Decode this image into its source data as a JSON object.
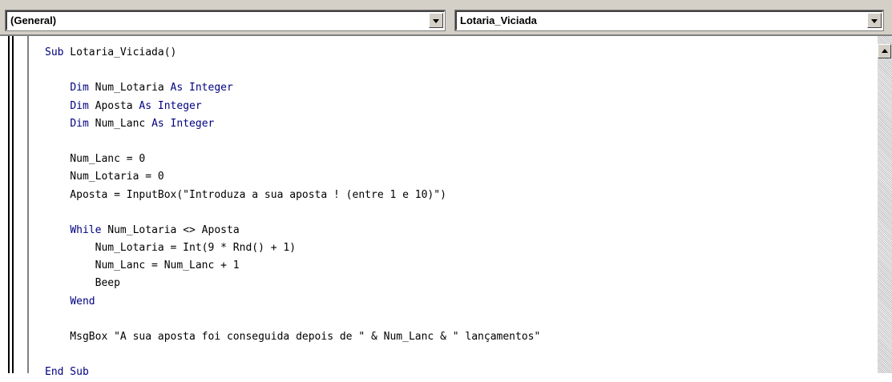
{
  "object_combo": {
    "value": "(General)"
  },
  "procedure_combo": {
    "value": "Lotaria_Viciada"
  },
  "code_lines": [
    [
      {
        "t": "Sub",
        "k": true
      },
      {
        "t": " Lotaria_Viciada()",
        "k": false
      }
    ],
    [],
    [
      {
        "t": "    ",
        "k": false
      },
      {
        "t": "Dim",
        "k": true
      },
      {
        "t": " Num_Lotaria ",
        "k": false
      },
      {
        "t": "As Integer",
        "k": true
      }
    ],
    [
      {
        "t": "    ",
        "k": false
      },
      {
        "t": "Dim",
        "k": true
      },
      {
        "t": " Aposta ",
        "k": false
      },
      {
        "t": "As Integer",
        "k": true
      }
    ],
    [
      {
        "t": "    ",
        "k": false
      },
      {
        "t": "Dim",
        "k": true
      },
      {
        "t": " Num_Lanc ",
        "k": false
      },
      {
        "t": "As Integer",
        "k": true
      }
    ],
    [],
    [
      {
        "t": "    Num_Lanc = 0",
        "k": false
      }
    ],
    [
      {
        "t": "    Num_Lotaria = 0",
        "k": false
      }
    ],
    [
      {
        "t": "    Aposta = InputBox(\"Introduza a sua aposta ! (entre 1 e 10)\")",
        "k": false
      }
    ],
    [],
    [
      {
        "t": "    ",
        "k": false
      },
      {
        "t": "While",
        "k": true
      },
      {
        "t": " Num_Lotaria <> Aposta",
        "k": false
      }
    ],
    [
      {
        "t": "        Num_Lotaria = Int(9 * Rnd() + 1)",
        "k": false
      }
    ],
    [
      {
        "t": "        Num_Lanc = Num_Lanc + 1",
        "k": false
      }
    ],
    [
      {
        "t": "        Beep",
        "k": false
      }
    ],
    [
      {
        "t": "    ",
        "k": false
      },
      {
        "t": "Wend",
        "k": true
      }
    ],
    [],
    [
      {
        "t": "    MsgBox \"A sua aposta foi conseguida depois de \" & Num_Lanc & \" lançamentos\"",
        "k": false
      }
    ],
    [],
    [
      {
        "t": "End Sub",
        "k": true
      }
    ]
  ],
  "colors": {
    "keyword": "#00007f",
    "text": "#000000",
    "chrome": "#d4d0c8"
  },
  "icons": {
    "combo_dropdown": "chevron-down-icon",
    "scroll_up": "arrow-up-icon"
  }
}
